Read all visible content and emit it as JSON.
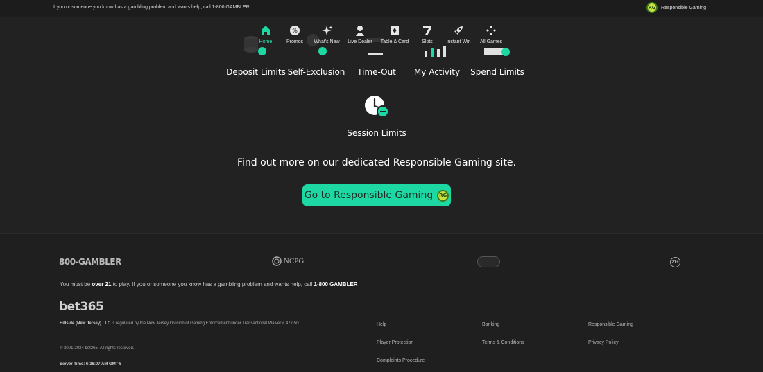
{
  "banner": {
    "message": "If you or someone you know has a gambling problem and wants help, call 1-800 GAMBLER",
    "rg_badge": "RG",
    "rg_label": "Responsible Gaming"
  },
  "nav": {
    "items": [
      {
        "label": "Home",
        "icon": "home-icon",
        "active": true
      },
      {
        "label": "Promos",
        "icon": "promos-icon"
      },
      {
        "label": "What's New",
        "icon": "sparkle-icon"
      },
      {
        "label": "Live Dealer",
        "icon": "dealer-icon"
      },
      {
        "label": "Table & Card",
        "icon": "cards-icon"
      },
      {
        "label": "Slots",
        "icon": "seven-icon"
      },
      {
        "label": "Instant Win",
        "icon": "rocket-icon"
      },
      {
        "label": "All Games",
        "icon": "diamonds-icon"
      }
    ]
  },
  "limits": {
    "deposit": "Deposit Limits",
    "self_exclusion": "Self-Exclusion",
    "time_out": "Time-Out",
    "activity": "My Activity",
    "spend": "Spend Limits",
    "session": "Session Limits"
  },
  "cta": {
    "find_more": "Find out more on our dedicated Responsible Gaming site.",
    "button_label": "Go to Responsible Gaming",
    "button_badge": "RG"
  },
  "footer": {
    "gambler_logo": "800-GAMBLER",
    "ncpg_logo": "NCPG",
    "age_badge": "21+",
    "age_msg_pre": "You must be ",
    "age_msg_bold": "over 21",
    "age_msg_mid": " to play. If you or someone you know has a gambling problem and wants help, call ",
    "age_msg_phone": "1-800 GAMBLER",
    "brand": "bet365",
    "legal_bold": "Hillside (New Jersey) LLC",
    "legal_rest": " is regulated by the New Jersey Division of Gaming Enforcement under Transactional Waiver # 477-50.",
    "copyright": "© 2001-2024 bet365. All rights reserved.",
    "server_time": "Server Time: 6:36:07 AM GMT-5",
    "links": {
      "help": "Help",
      "player_protection": "Player Protection",
      "complaints": "Complaints Procedure",
      "banking": "Banking",
      "terms": "Terms & Conditions",
      "responsible_gaming": "Responsible Gaming",
      "privacy": "Privacy Policy"
    }
  },
  "colors": {
    "accent": "#1ed8a3",
    "background": "#222222",
    "footer": "#1f1f1f"
  }
}
